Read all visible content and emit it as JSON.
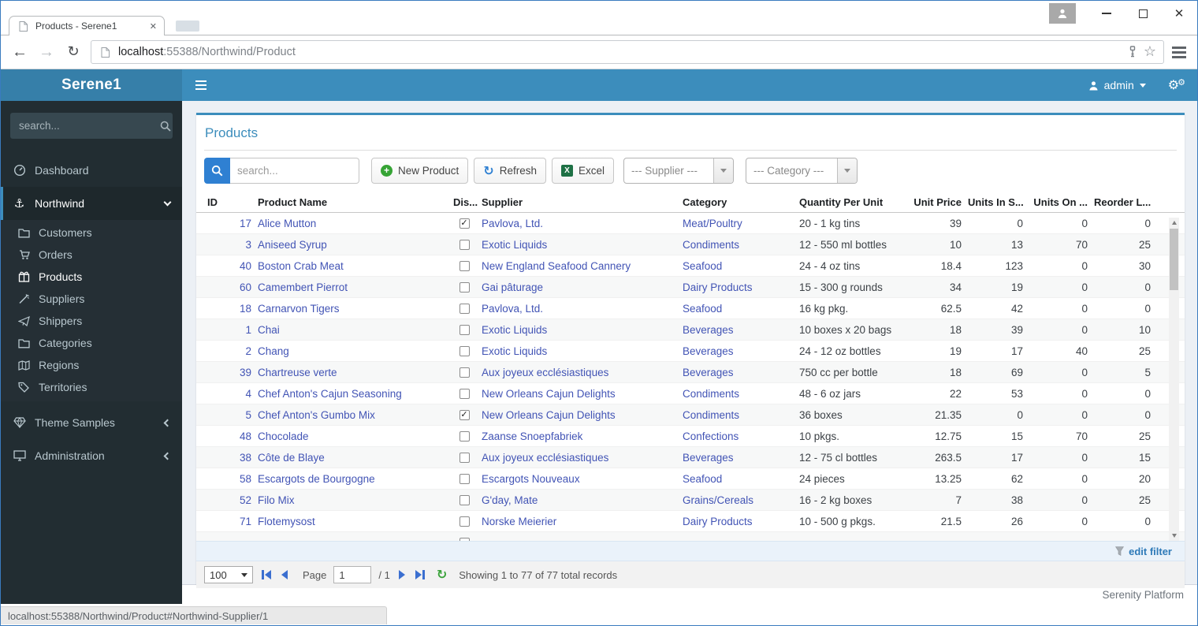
{
  "browser": {
    "tab_title": "Products - Serene1",
    "url_host": "localhost",
    "url_rest": ":55388/Northwind/Product",
    "status_tooltip": "localhost:55388/Northwind/Product#Northwind-Supplier/1"
  },
  "topnav": {
    "user_label": "admin"
  },
  "sidebar": {
    "brand": "Serene1",
    "search_placeholder": "search...",
    "dashboard_label": "Dashboard",
    "northwind_label": "Northwind",
    "children": [
      "Customers",
      "Orders",
      "Products",
      "Suppliers",
      "Shippers",
      "Categories",
      "Regions",
      "Territories"
    ],
    "theme_samples_label": "Theme Samples",
    "administration_label": "Administration"
  },
  "page": {
    "title": "Products",
    "toolbar": {
      "search_placeholder": "search...",
      "new_product_label": "New Product",
      "refresh_label": "Refresh",
      "excel_label": "Excel",
      "supplier_filter": "--- Supplier ---",
      "category_filter": "--- Category ---"
    },
    "grid": {
      "columns": [
        "ID",
        "Product Name",
        "Dis...",
        "Supplier",
        "Category",
        "Quantity Per Unit",
        "Unit Price",
        "Units In S...",
        "Units On ...",
        "Reorder L..."
      ],
      "rows": [
        {
          "id": "17",
          "name": "Alice Mutton",
          "discontinued": true,
          "supplier": "Pavlova, Ltd.",
          "category": "Meat/Poultry",
          "qty": "20 - 1 kg tins",
          "price": "39",
          "stock": "0",
          "order": "0",
          "reorder": "0"
        },
        {
          "id": "3",
          "name": "Aniseed Syrup",
          "discontinued": false,
          "supplier": "Exotic Liquids",
          "category": "Condiments",
          "qty": "12 - 550 ml bottles",
          "price": "10",
          "stock": "13",
          "order": "70",
          "reorder": "25"
        },
        {
          "id": "40",
          "name": "Boston Crab Meat",
          "discontinued": false,
          "supplier": "New England Seafood Cannery",
          "category": "Seafood",
          "qty": "24 - 4 oz tins",
          "price": "18.4",
          "stock": "123",
          "order": "0",
          "reorder": "30"
        },
        {
          "id": "60",
          "name": "Camembert Pierrot",
          "discontinued": false,
          "supplier": "Gai pâturage",
          "category": "Dairy Products",
          "qty": "15 - 300 g rounds",
          "price": "34",
          "stock": "19",
          "order": "0",
          "reorder": "0"
        },
        {
          "id": "18",
          "name": "Carnarvon Tigers",
          "discontinued": false,
          "supplier": "Pavlova, Ltd.",
          "category": "Seafood",
          "qty": "16 kg pkg.",
          "price": "62.5",
          "stock": "42",
          "order": "0",
          "reorder": "0"
        },
        {
          "id": "1",
          "name": "Chai",
          "discontinued": false,
          "supplier": "Exotic Liquids",
          "category": "Beverages",
          "qty": "10 boxes x 20 bags",
          "price": "18",
          "stock": "39",
          "order": "0",
          "reorder": "10"
        },
        {
          "id": "2",
          "name": "Chang",
          "discontinued": false,
          "supplier": "Exotic Liquids",
          "category": "Beverages",
          "qty": "24 - 12 oz bottles",
          "price": "19",
          "stock": "17",
          "order": "40",
          "reorder": "25"
        },
        {
          "id": "39",
          "name": "Chartreuse verte",
          "discontinued": false,
          "supplier": "Aux joyeux ecclésiastiques",
          "category": "Beverages",
          "qty": "750 cc per bottle",
          "price": "18",
          "stock": "69",
          "order": "0",
          "reorder": "5"
        },
        {
          "id": "4",
          "name": "Chef Anton's Cajun Seasoning",
          "discontinued": false,
          "supplier": "New Orleans Cajun Delights",
          "category": "Condiments",
          "qty": "48 - 6 oz jars",
          "price": "22",
          "stock": "53",
          "order": "0",
          "reorder": "0"
        },
        {
          "id": "5",
          "name": "Chef Anton's Gumbo Mix",
          "discontinued": true,
          "supplier": "New Orleans Cajun Delights",
          "category": "Condiments",
          "qty": "36 boxes",
          "price": "21.35",
          "stock": "0",
          "order": "0",
          "reorder": "0"
        },
        {
          "id": "48",
          "name": "Chocolade",
          "discontinued": false,
          "supplier": "Zaanse Snoepfabriek",
          "category": "Confections",
          "qty": "10 pkgs.",
          "price": "12.75",
          "stock": "15",
          "order": "70",
          "reorder": "25"
        },
        {
          "id": "38",
          "name": "Côte de Blaye",
          "discontinued": false,
          "supplier": "Aux joyeux ecclésiastiques",
          "category": "Beverages",
          "qty": "12 - 75 cl bottles",
          "price": "263.5",
          "stock": "17",
          "order": "0",
          "reorder": "15"
        },
        {
          "id": "58",
          "name": "Escargots de Bourgogne",
          "discontinued": false,
          "supplier": "Escargots Nouveaux",
          "category": "Seafood",
          "qty": "24 pieces",
          "price": "13.25",
          "stock": "62",
          "order": "0",
          "reorder": "20"
        },
        {
          "id": "52",
          "name": "Filo Mix",
          "discontinued": false,
          "supplier": "G'day, Mate",
          "category": "Grains/Cereals",
          "qty": "16 - 2 kg boxes",
          "price": "7",
          "stock": "38",
          "order": "0",
          "reorder": "25"
        },
        {
          "id": "71",
          "name": "Flotemysost",
          "discontinued": false,
          "supplier": "Norske Meierier",
          "category": "Dairy Products",
          "qty": "10 - 500 g pkgs.",
          "price": "21.5",
          "stock": "26",
          "order": "0",
          "reorder": "0"
        },
        {
          "id": "",
          "name": "",
          "discontinued": false,
          "supplier": "",
          "category": "",
          "qty": "",
          "price": "",
          "stock": "",
          "order": "",
          "reorder": "",
          "partial": true
        }
      ]
    },
    "filter_bar": {
      "edit_filter_label": "edit filter"
    },
    "pager": {
      "page_size": "100",
      "page_label": "Page",
      "page_value": "1",
      "page_total": "/ 1",
      "summary": "Showing 1 to 77 of 77 total records"
    }
  },
  "footer": {
    "brand": "Serenity Platform"
  },
  "colors": {
    "navbar": "#3c8dbc",
    "sidebar_brand": "#367fa9",
    "sidebar_bg": "#222d32",
    "panel_accent": "#3c8dbc",
    "grid_link": "#4254b5",
    "quick_search_button": "#2f80d2"
  }
}
